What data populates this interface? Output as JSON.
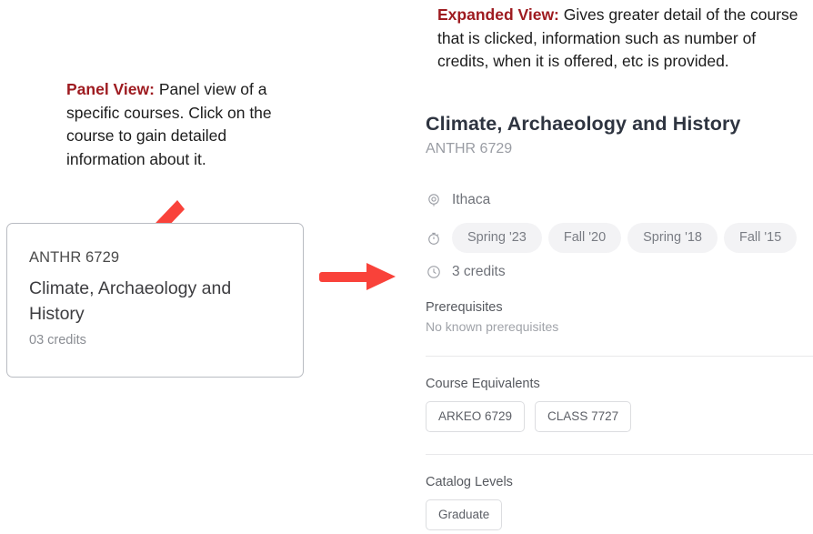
{
  "annotations": {
    "panel": {
      "lead": "Panel View:",
      "body": " Panel view of a specific courses. Click on the course to gain detailed information about it."
    },
    "expanded": {
      "lead": "Expanded View:",
      "body": " Gives greater detail of the course that is clicked, information such as number of credits, when it is offered, etc is provided."
    },
    "arrow_color": "#f9423a"
  },
  "course_card": {
    "code": "ANTHR 6729",
    "title": "Climate, Archaeology and History",
    "credits": "03 credits"
  },
  "expanded_panel": {
    "title": "Climate, Archaeology and History",
    "code": "ANTHR 6729",
    "location": {
      "icon": "map-pin-icon",
      "value": "Ithaca"
    },
    "semesters": {
      "icon": "stopwatch-icon",
      "items": [
        "Spring '23",
        "Fall '20",
        "Spring '18",
        "Fall '15"
      ]
    },
    "credits": {
      "icon": "clock-icon",
      "value": "3 credits"
    },
    "prerequisites": {
      "label": "Prerequisites",
      "value": "No known prerequisites"
    },
    "course_equivalents": {
      "label": "Course Equivalents",
      "items": [
        "ARKEO 6729",
        "CLASS 7727"
      ]
    },
    "catalog_levels": {
      "label": "Catalog Levels",
      "items": [
        "Graduate"
      ]
    }
  }
}
